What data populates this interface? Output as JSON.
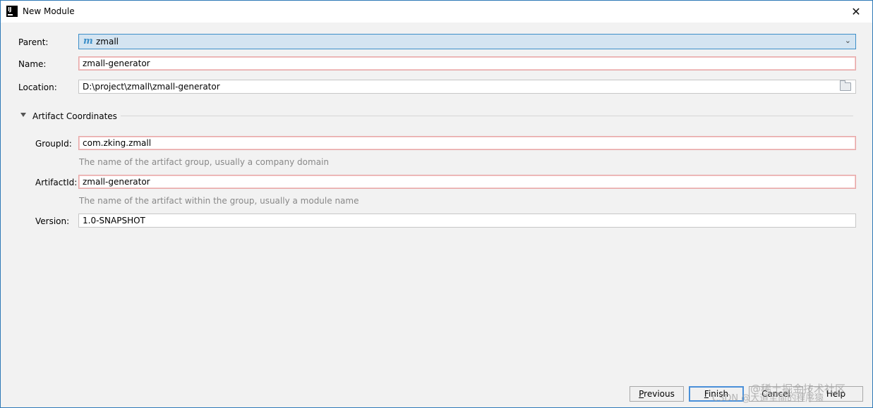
{
  "window": {
    "title": "New Module",
    "close_glyph": "✕",
    "app_icon_text": "IJ"
  },
  "form": {
    "parent": {
      "label": "Parent:",
      "value": "zmall",
      "icon": "maven-module-icon"
    },
    "name": {
      "label": "Name:",
      "value": "zmall-generator"
    },
    "location": {
      "label": "Location:",
      "value": "D:\\project\\zmall\\zmall-generator"
    }
  },
  "artifact": {
    "section_title": "Artifact Coordinates",
    "group_id": {
      "label": "GroupId:",
      "value": "com.zking.zmall",
      "hint": "The name of the artifact group, usually a company domain"
    },
    "artifact_id": {
      "label": "ArtifactId:",
      "value": "zmall-generator",
      "hint": "The name of the artifact within the group, usually a module name"
    },
    "version": {
      "label": "Version:",
      "value": "1.0-SNAPSHOT"
    }
  },
  "buttons": {
    "previous": {
      "mnemonic": "P",
      "rest": "revious"
    },
    "finish": {
      "mnemonic": "F",
      "rest": "inish"
    },
    "cancel": "Cancel",
    "help": "Help"
  },
  "watermark": {
    "line1": "@稀土掘金技术社区",
    "line2": "CSDN @大道至简的程序猿"
  },
  "colors": {
    "accent": "#3d8fc8",
    "error_border": "#e7a7a7",
    "hint": "#888888"
  }
}
